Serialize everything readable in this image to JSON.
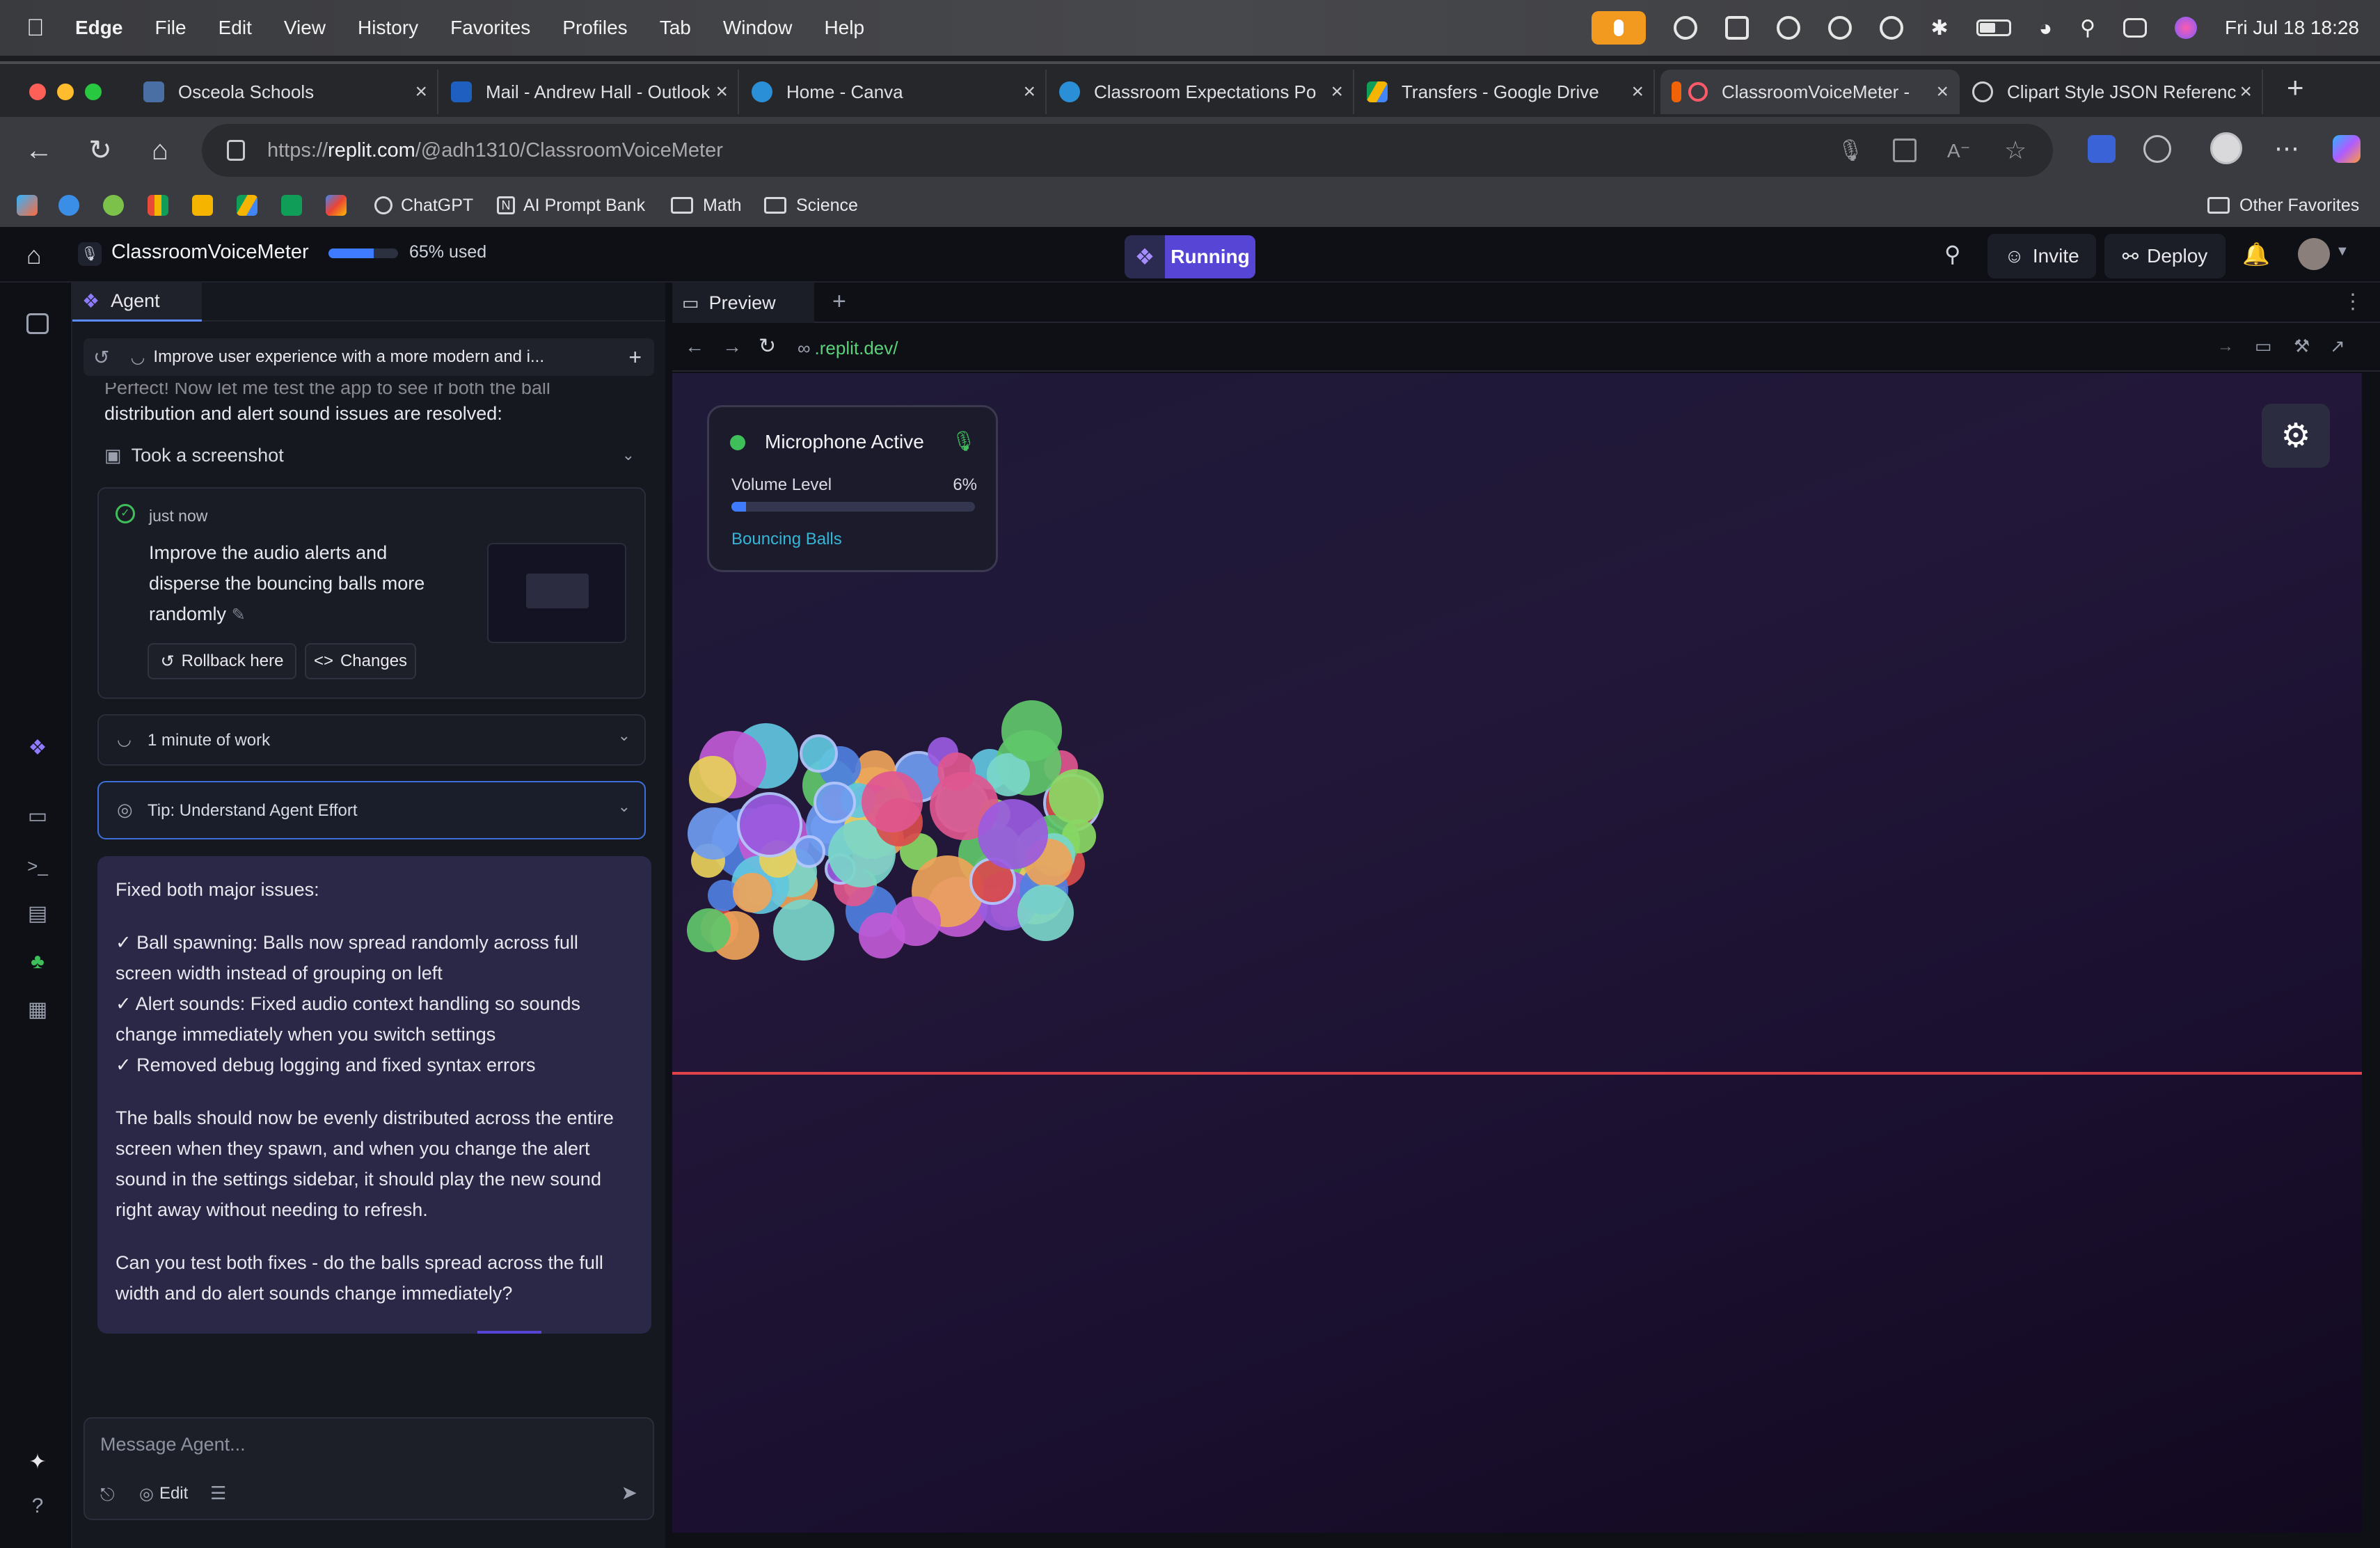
{
  "menubar": {
    "app": "Edge",
    "items": [
      "File",
      "Edit",
      "View",
      "History",
      "Favorites",
      "Profiles",
      "Tab",
      "Window",
      "Help"
    ],
    "clock": "Fri Jul 18  18:28"
  },
  "tabs": [
    {
      "title": "Osceola Schools",
      "color": "#4a6fa5"
    },
    {
      "title": "Mail - Andrew Hall - Outlook",
      "color": "#1f5fbf"
    },
    {
      "title": "Home - Canva",
      "color": "#2a8fd6"
    },
    {
      "title": "Classroom Expectations Po",
      "color": "#2a8fd6"
    },
    {
      "title": "Transfers - Google Drive",
      "color": "#f4b400"
    },
    {
      "title": "ClassroomVoiceMeter -",
      "color": "#f26207",
      "active": true
    },
    {
      "title": "Clipart Style JSON Referenc",
      "color": "#cfcfd3"
    }
  ],
  "address": {
    "prefix": "https://",
    "host": "replit.com",
    "path": "/@adh1310/ClassroomVoiceMeter"
  },
  "favorites": {
    "chatgpt": "ChatGPT",
    "prompt_bank": "AI Prompt Bank",
    "math": "Math",
    "science": "Science",
    "other": "Other Favorites"
  },
  "app": {
    "project": "ClassroomVoiceMeter",
    "usage_label": "65% used",
    "usage_fraction": 0.65,
    "status": "Running",
    "invite": "Invite",
    "deploy": "Deploy"
  },
  "agent": {
    "tab": "Agent",
    "thread": "Improve user experience with a more modern and i...",
    "intro_faded": "Perfect! Now let me test the app to see if both the ball",
    "intro": "distribution and alert sound issues are resolved:",
    "screenshot_label": "Took a screenshot",
    "checkpoint_time": "just now",
    "checkpoint_text": "Improve the audio alerts and disperse the bouncing balls more randomly",
    "rollback": "Rollback here",
    "changes": "Changes",
    "work": "1 minute of work",
    "tip": "Tip: Understand Agent Effort",
    "msg_heading": "Fixed both major issues:",
    "msg_items": [
      "✓ Ball spawning: Balls now spread randomly across full screen width instead of grouping on left",
      "✓ Alert sounds: Fixed audio context handling so sounds change immediately when you switch settings",
      "✓ Removed debug logging and fixed syntax errors"
    ],
    "msg_p2": "The balls should now be evenly distributed across the entire screen when they spawn, and when you change the alert sound in the settings sidebar, it should play the new sound right away without needing to refresh.",
    "msg_p3": "Can you test both fixes - do the balls spread across the full width and do alert sounds change immediately?",
    "composer_placeholder": "Message Agent...",
    "edit": "Edit"
  },
  "preview": {
    "tab": "Preview",
    "url": ".replit.dev/",
    "mic_status": "Microphone Active",
    "volume_label": "Volume Level",
    "volume_value": "6%",
    "volume_fraction": 0.06,
    "mode": "Bouncing Balls"
  },
  "colors": {
    "accent": "#5746d6",
    "running": "#5746d6",
    "mic_dot": "#3fbf5a",
    "link": "#35b6d6",
    "alert_line": "#e0434a"
  }
}
